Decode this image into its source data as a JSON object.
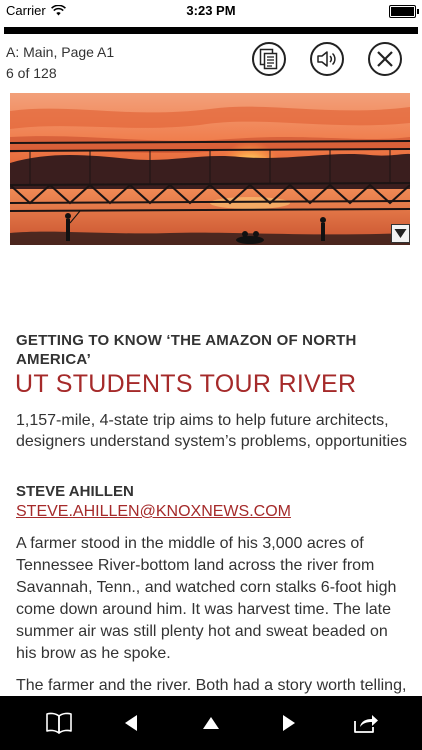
{
  "status_bar": {
    "carrier": "Carrier",
    "time": "3:23 PM"
  },
  "header": {
    "section": "A: Main, Page A1",
    "page_count": "6 of 128",
    "pages_icon": "pages-icon",
    "audio_icon": "speaker-icon",
    "close_icon": "close-icon"
  },
  "photo": {
    "subject": "sunset over river with truss bridge",
    "expand_icon": "expand-down-icon"
  },
  "article": {
    "kicker": "GETTING TO KNOW ‘THE AMAZON OF NORTH AMERICA’",
    "headline": "UT STUDENTS TOUR RIVER",
    "deck": "1,157-mile, 4-state trip aims to help future architects, designers understand system’s problems, opportunities",
    "byline": "STEVE AHILLEN",
    "email": "STEVE.AHILLEN@KNOXNEWS.COM",
    "paragraphs": [
      "A farmer stood in the middle of his 3,000 acres of Tennessee River-bottom land across the river from Savannah, Tenn., and watched corn stalks 6-foot high come down around him. It was harvest time. The late summer air was still plenty hot and sweat beaded on his brow as he spoke.",
      "The farmer and the river. Both had a story worth telling, and they were there to listen."
    ]
  },
  "toolbar": {
    "icons": [
      "book-icon",
      "previous-icon",
      "up-icon",
      "next-icon",
      "share-icon"
    ]
  },
  "colors": {
    "accent": "#a52a2a",
    "text": "#333333",
    "toolbar": "#000000"
  }
}
